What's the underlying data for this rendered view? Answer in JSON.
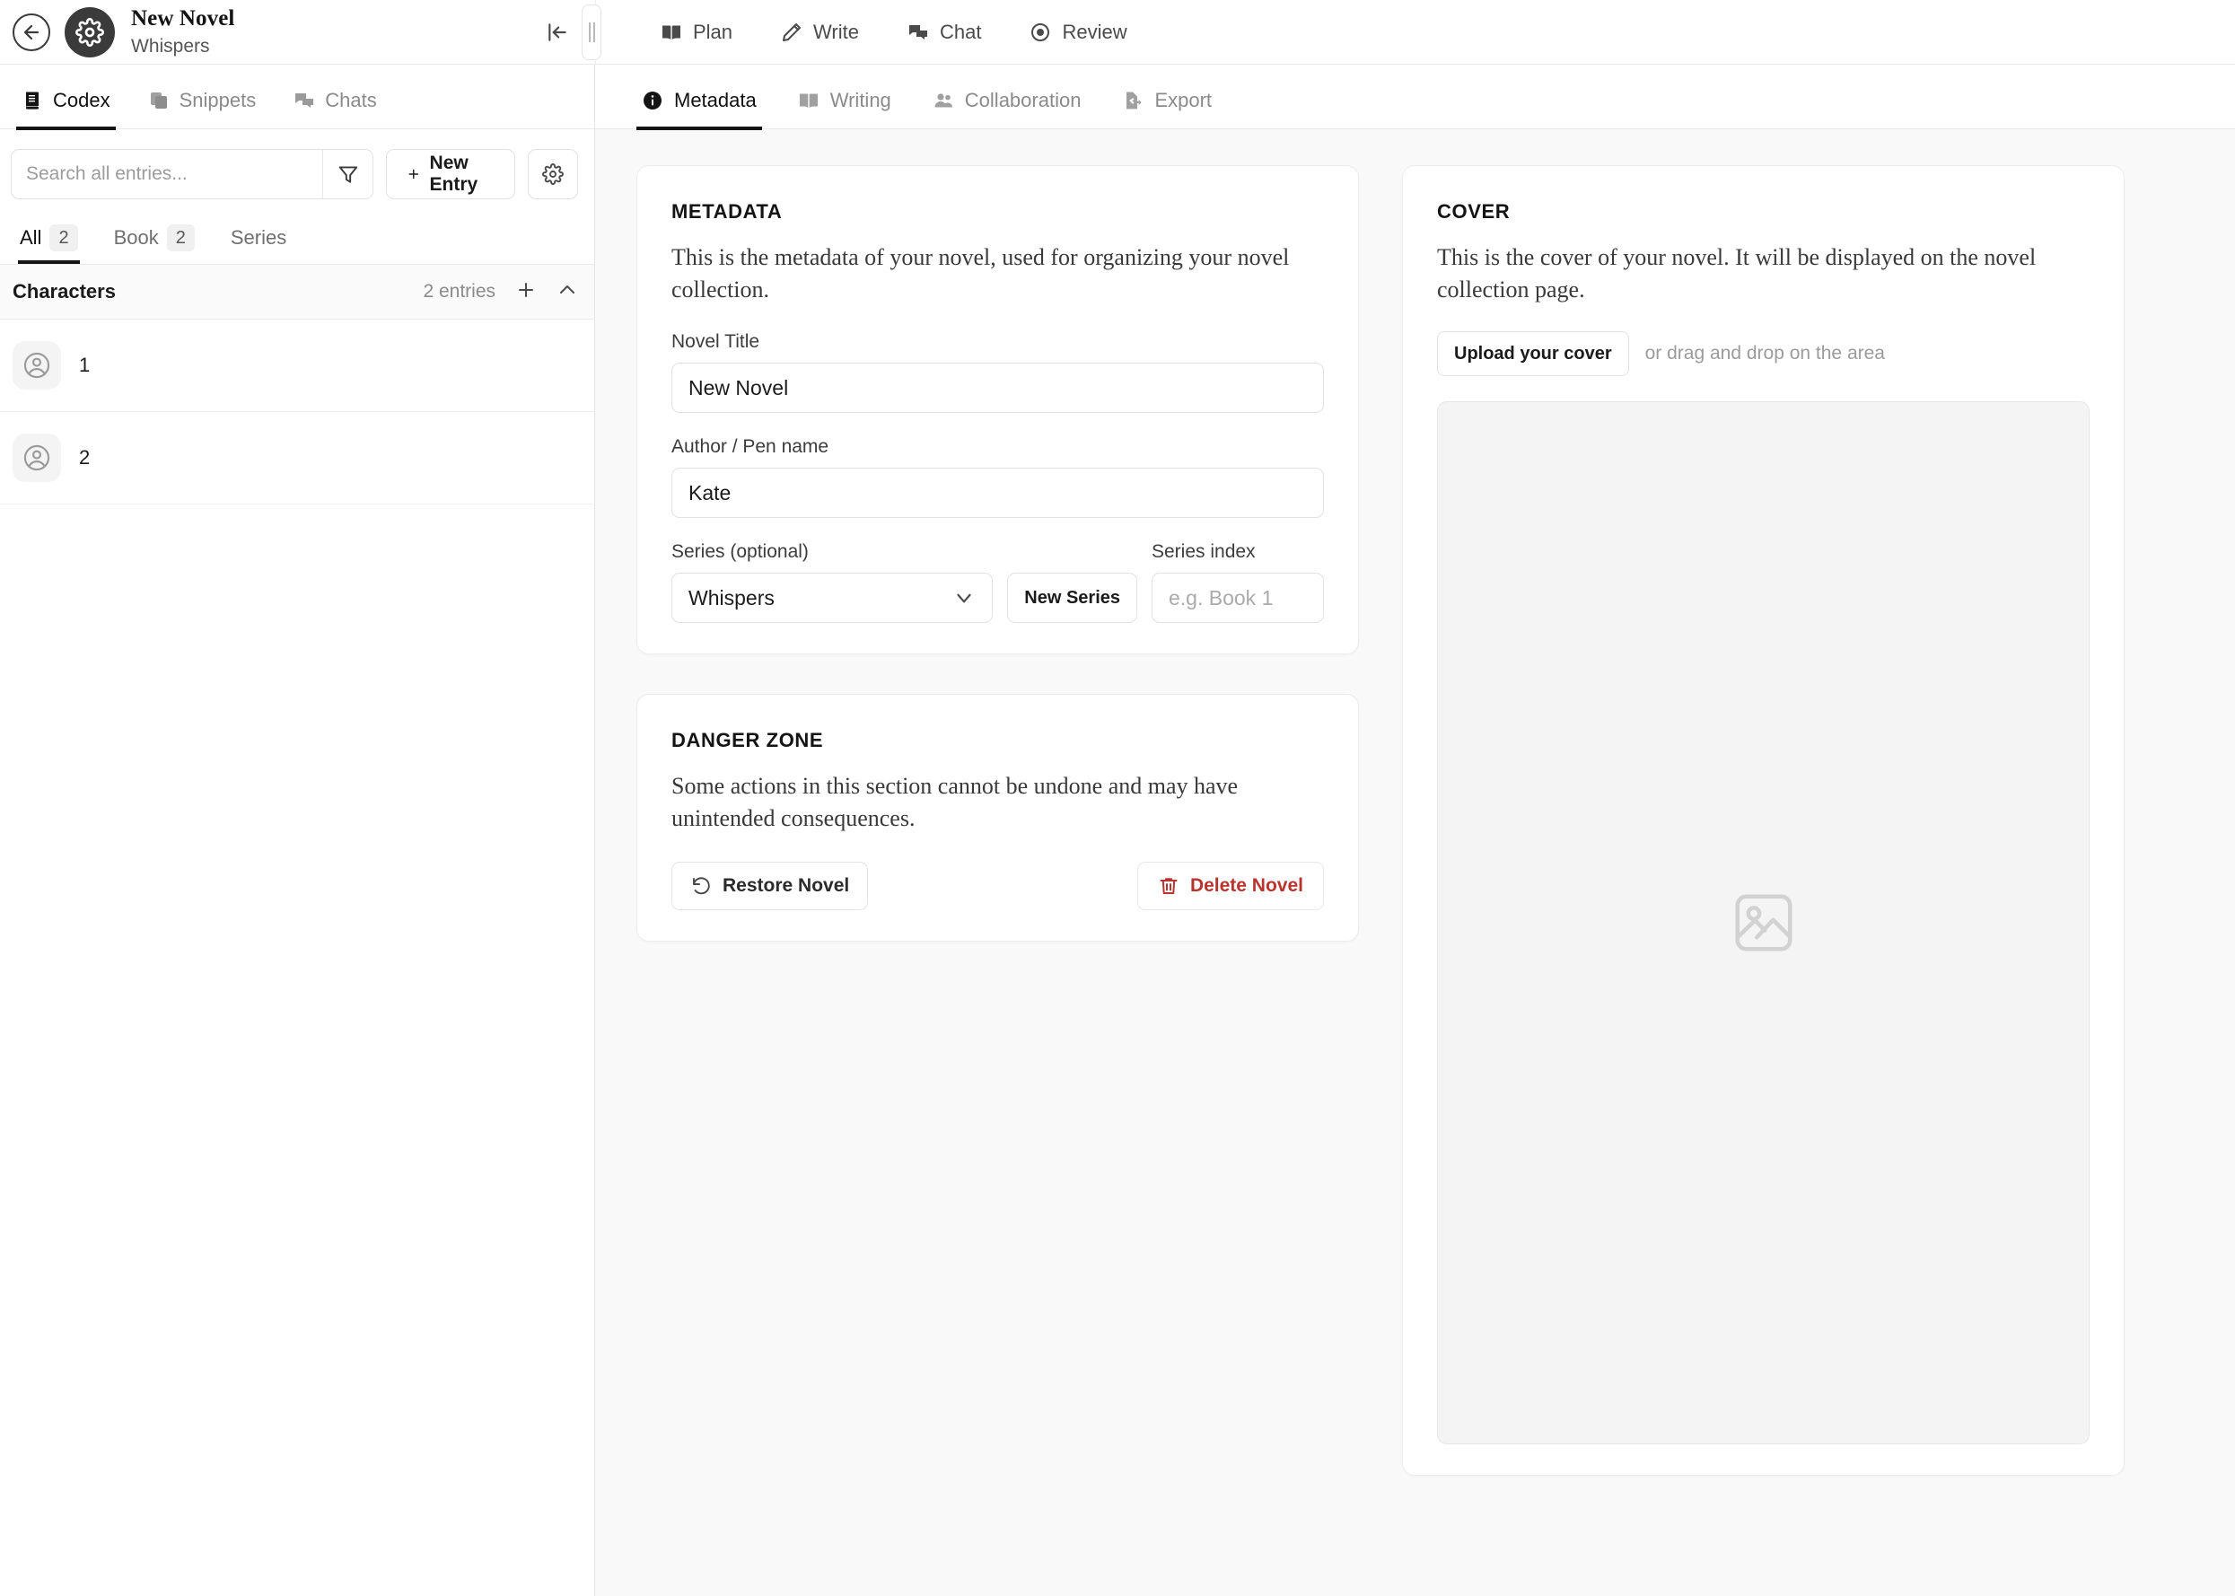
{
  "header": {
    "back_icon": "arrow-left-circle-icon",
    "avatar_icon": "gear-icon",
    "novel_title": "New Novel",
    "novel_series": "Whispers",
    "collapse_icon": "collapse-panel-left-icon",
    "resize_icon": "panel-resize-handle"
  },
  "top_nav": {
    "items": [
      {
        "label": "Plan",
        "icon": "book-open-icon"
      },
      {
        "label": "Write",
        "icon": "pencil-icon"
      },
      {
        "label": "Chat",
        "icon": "chat-bubbles-icon"
      },
      {
        "label": "Review",
        "icon": "eye-icon"
      }
    ]
  },
  "sidebar": {
    "tabs": [
      {
        "label": "Codex",
        "icon": "book-icon",
        "active": true
      },
      {
        "label": "Snippets",
        "icon": "copy-icon",
        "active": false
      },
      {
        "label": "Chats",
        "icon": "chat-bubbles-icon",
        "active": false
      }
    ],
    "search": {
      "placeholder": "Search all entries...",
      "value": "",
      "filter_icon": "funnel-icon"
    },
    "new_entry_label": "New Entry",
    "new_entry_icon": "plus-icon",
    "settings_icon": "gear-icon",
    "filters": [
      {
        "label": "All",
        "count": "2",
        "active": true
      },
      {
        "label": "Book",
        "count": "2",
        "active": false
      },
      {
        "label": "Series",
        "count": "",
        "active": false
      }
    ],
    "group": {
      "title": "Characters",
      "count_label": "2 entries",
      "add_icon": "plus-icon",
      "collapse_icon": "chevron-up-icon"
    },
    "entries": [
      {
        "name": "1",
        "icon": "user-circle-icon"
      },
      {
        "name": "2",
        "icon": "user-circle-icon"
      }
    ]
  },
  "sub_tabs": {
    "items": [
      {
        "label": "Metadata",
        "icon": "info-circle-icon",
        "active": true
      },
      {
        "label": "Writing",
        "icon": "book-open-icon",
        "active": false
      },
      {
        "label": "Collaboration",
        "icon": "users-icon",
        "active": false
      },
      {
        "label": "Export",
        "icon": "file-export-icon",
        "active": false
      }
    ]
  },
  "metadata_card": {
    "title": "METADATA",
    "description": "This is the metadata of your novel, used for organizing your novel collection.",
    "novel_title_label": "Novel Title",
    "novel_title_value": "New Novel",
    "author_label": "Author / Pen name",
    "author_value": "Kate",
    "series_label": "Series (optional)",
    "series_value": "Whispers",
    "series_chevron_icon": "chevron-down-icon",
    "new_series_label": "New Series",
    "series_index_label": "Series index",
    "series_index_value": "",
    "series_index_placeholder": "e.g. Book 1"
  },
  "danger_card": {
    "title": "DANGER ZONE",
    "description": "Some actions in this section cannot be undone and may have unintended consequences.",
    "restore_label": "Restore Novel",
    "restore_icon": "rotate-ccw-icon",
    "delete_label": "Delete Novel",
    "delete_icon": "trash-icon",
    "danger_color": "#b8352e"
  },
  "cover_card": {
    "title": "COVER",
    "description": "This is the cover of your novel. It will be displayed on the novel collection page.",
    "upload_label": "Upload your cover",
    "drag_hint": "or drag and drop on the area",
    "placeholder_icon": "image-placeholder-icon"
  },
  "theme": {
    "accent": "#141414",
    "page_bg": "#f9f9f9",
    "card_bg": "#ffffff",
    "border": "#e2e2e2",
    "muted_text": "#8a8a8a"
  }
}
